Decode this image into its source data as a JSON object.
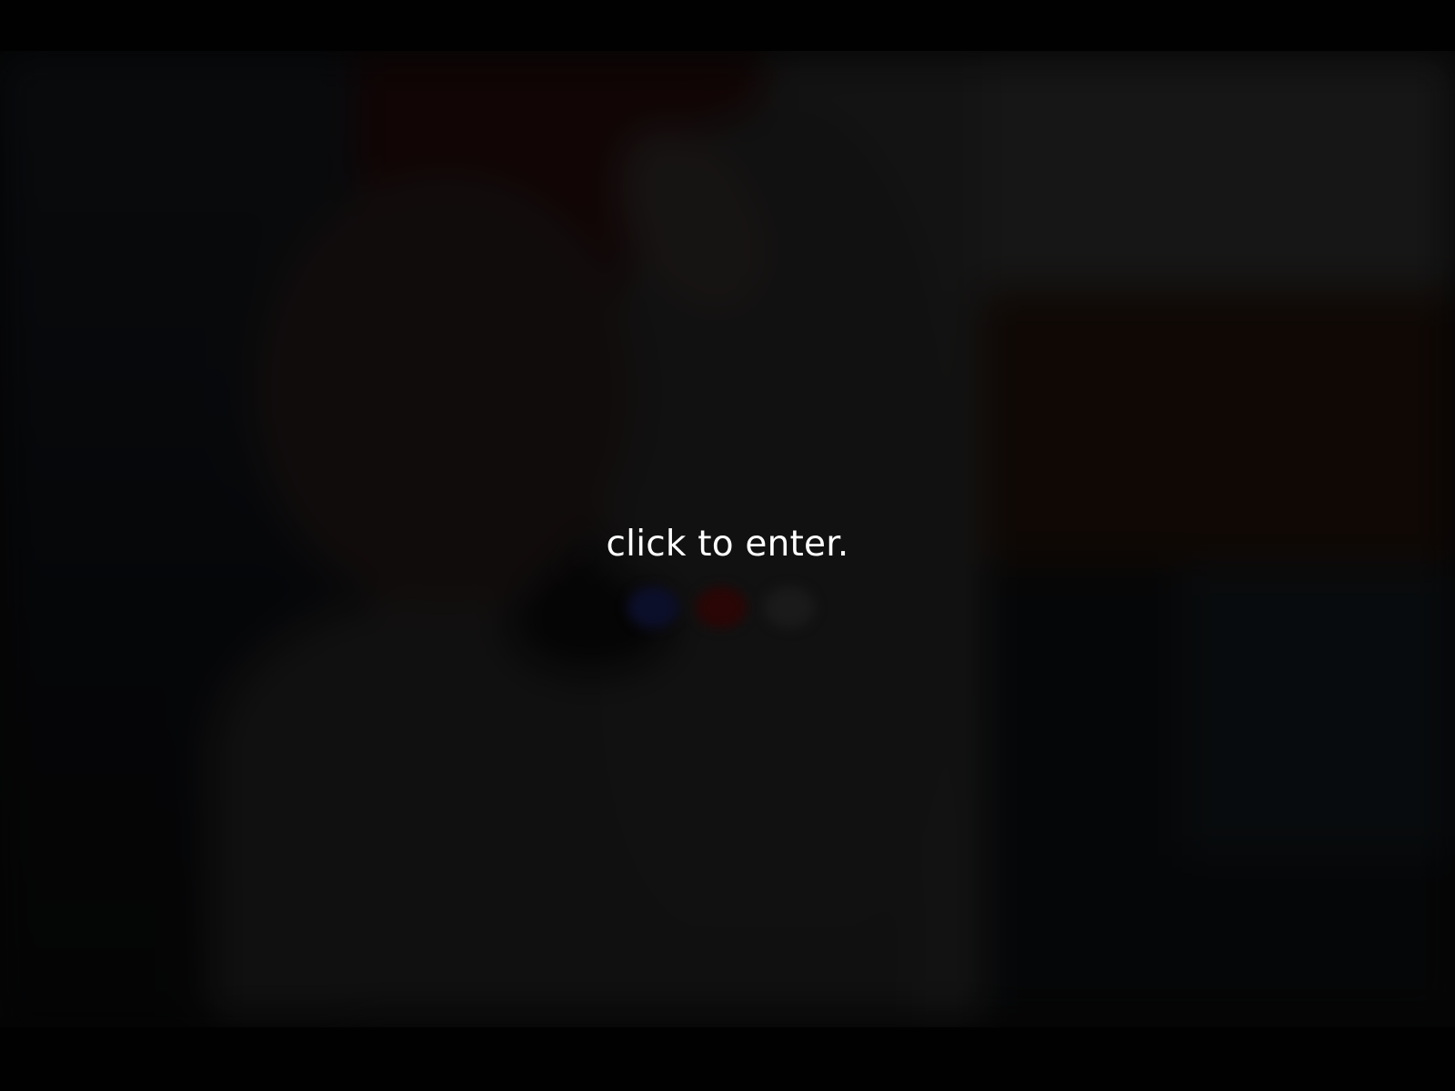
{
  "overlay": {
    "prompt": "click to enter."
  },
  "colors": {
    "background": "#060606",
    "text": "#ffffff"
  }
}
